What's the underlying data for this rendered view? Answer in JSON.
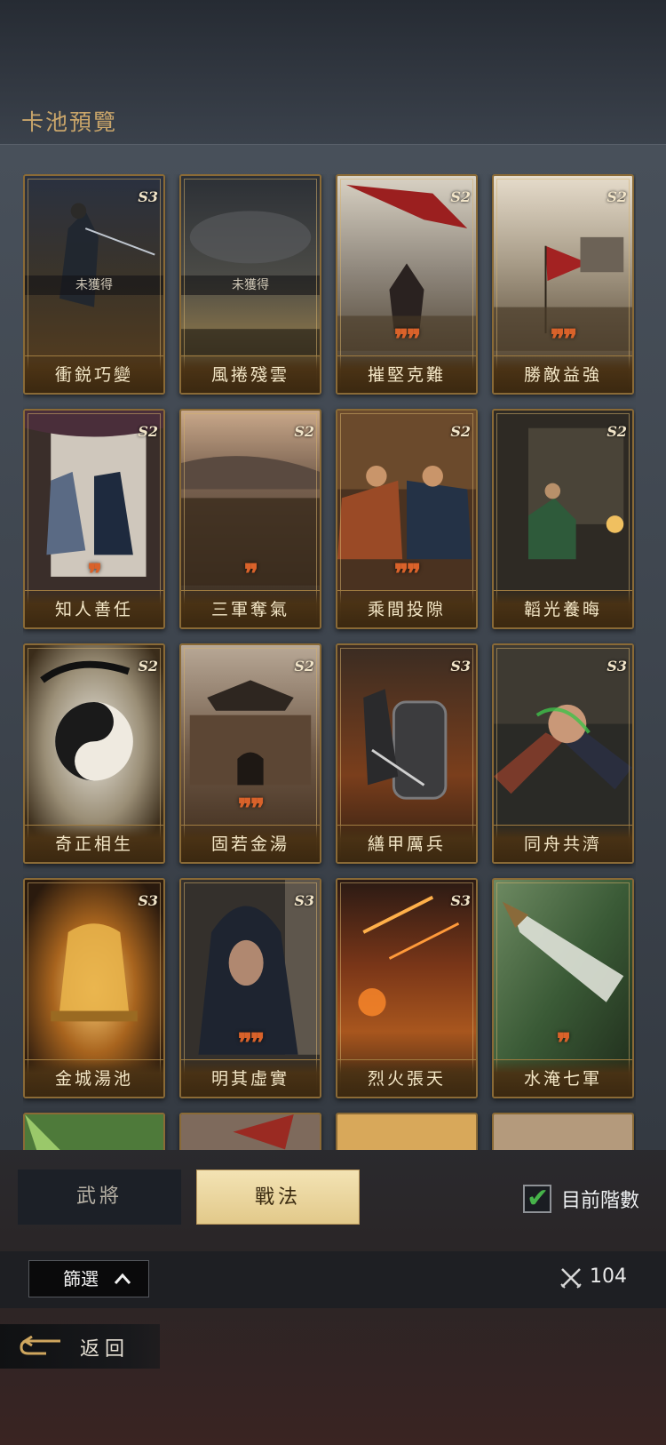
{
  "header": {
    "title": "卡池預覽"
  },
  "colors": {
    "accent_gold": "#c9a56a",
    "active_tab_bg": "#f0dfae",
    "check_green": "#46b34a",
    "quote_orange": "#d9622a"
  },
  "cards": [
    {
      "name": "衝鋭巧變",
      "grade": "S3",
      "status": "未獲得",
      "quotes": ""
    },
    {
      "name": "風捲殘雲",
      "grade": "",
      "status": "未獲得",
      "quotes": ""
    },
    {
      "name": "摧堅克難",
      "grade": "S2",
      "status": "",
      "quotes": "❞❞"
    },
    {
      "name": "勝敵益強",
      "grade": "S2",
      "status": "",
      "quotes": "❞❞"
    },
    {
      "name": "知人善任",
      "grade": "S2",
      "status": "",
      "quotes": "❞"
    },
    {
      "name": "三軍奪氣",
      "grade": "S2",
      "status": "",
      "quotes": "❞"
    },
    {
      "name": "乘間投隙",
      "grade": "S2",
      "status": "",
      "quotes": "❞❞"
    },
    {
      "name": "韜光養晦",
      "grade": "S2",
      "status": "",
      "quotes": ""
    },
    {
      "name": "奇正相生",
      "grade": "S2",
      "status": "",
      "quotes": ""
    },
    {
      "name": "固若金湯",
      "grade": "S2",
      "status": "",
      "quotes": "❞❞"
    },
    {
      "name": "繕甲厲兵",
      "grade": "S3",
      "status": "",
      "quotes": ""
    },
    {
      "name": "同舟共濟",
      "grade": "S3",
      "status": "",
      "quotes": ""
    },
    {
      "name": "金城湯池",
      "grade": "S3",
      "status": "",
      "quotes": ""
    },
    {
      "name": "明其虛實",
      "grade": "S3",
      "status": "",
      "quotes": "❞❞"
    },
    {
      "name": "烈火張天",
      "grade": "S3",
      "status": "",
      "quotes": ""
    },
    {
      "name": "水淹七軍",
      "grade": "",
      "status": "",
      "quotes": "❞"
    }
  ],
  "tabs": {
    "general": "武將",
    "tactic": "戰法"
  },
  "filter": {
    "current_tier_label": "目前階數",
    "current_tier_checked": true,
    "filter_label": "篩選",
    "filter_chevron": "^",
    "count": "104"
  },
  "footer": {
    "back_label": "返回"
  }
}
